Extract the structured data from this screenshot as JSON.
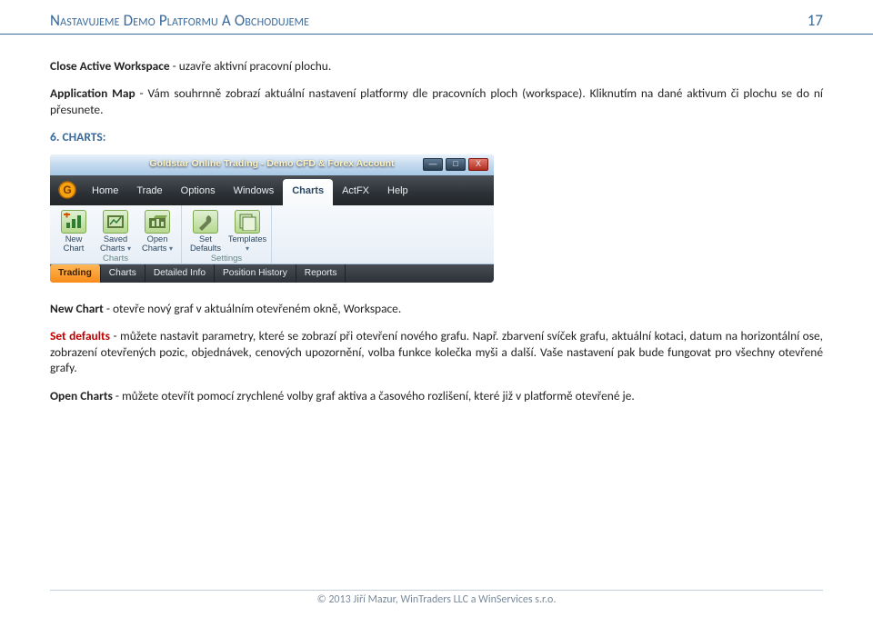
{
  "header": {
    "title": "Nastavujeme Demo Platformu A Obchodujeme",
    "page": "17"
  },
  "para1": {
    "b": "Close Active Workspace",
    "rest": " - uzavře aktivní pracovní plochu."
  },
  "para2": {
    "b": "Application Map",
    "rest": " - Vám souhrnně zobrazí aktuální nastavení platformy dle pracovních ploch (workspace). Kliknutím na dané aktivum či plochu se do ní přesunete."
  },
  "section": "6.  CHARTS:",
  "app": {
    "title": "Goldstar Online Trading - Demo CFD & Forex Account",
    "winctrl": {
      "min": "—",
      "max": "□",
      "close": "X"
    },
    "menu": [
      "Home",
      "Trade",
      "Options",
      "Windows",
      "Charts",
      "ActFX",
      "Help"
    ],
    "menuActive": 4,
    "ribbon": {
      "groups": [
        {
          "label": "Charts",
          "buttons": [
            {
              "label1": "New",
              "label2": "Chart",
              "icon": "chart-plus"
            },
            {
              "label1": "Saved",
              "label2": "Charts",
              "icon": "chart-saved",
              "chev": true
            },
            {
              "label1": "Open",
              "label2": "Charts",
              "icon": "chart-open",
              "chev": true
            }
          ]
        },
        {
          "label": "Settings",
          "buttons": [
            {
              "label1": "Set",
              "label2": "Defaults",
              "icon": "wrench"
            },
            {
              "label1": "Templates",
              "label2": "",
              "icon": "templates",
              "chev": true
            }
          ]
        }
      ]
    },
    "tabs": [
      "Trading",
      "Charts",
      "Detailed Info",
      "Position History",
      "Reports"
    ],
    "tabActive": 0
  },
  "p3": {
    "b": "New Chart",
    "rest": " - otevře nový graf v aktuálním otevřeném okně, Workspace."
  },
  "p4": {
    "b": "Set defaults",
    "rest": " - můžete nastavit parametry, které se zobrazí při otevření nového grafu. Např. zbarvení svíček grafu, aktuální kotaci, datum na horizontální ose, zobrazení otevřených pozic, objednávek, cenových upozornění, volba funkce kolečka myši a další. Vaše nastavení pak bude fungovat pro všechny otevřené grafy."
  },
  "p5": {
    "b": "Open Charts",
    "rest": " - můžete otevřít pomocí zrychlené volby graf aktiva a časového rozlišení, které již v platformě otevřené je."
  },
  "footer": "© 2013 Jiří Mazur, WinTraders LLC a WinServices s.r.o."
}
